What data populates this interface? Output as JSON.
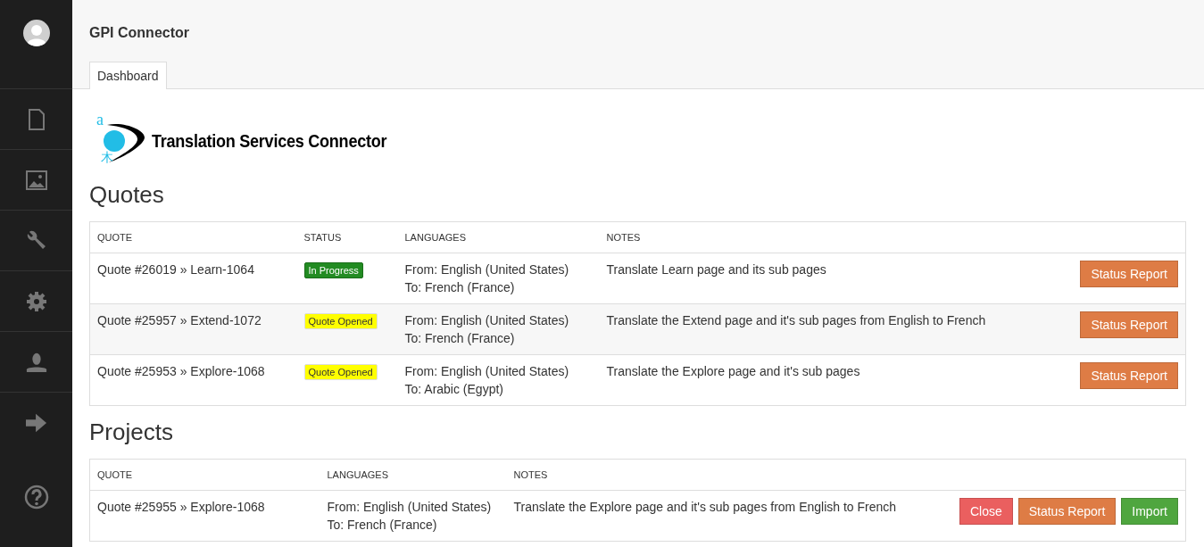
{
  "header": {
    "title": "GPI Connector"
  },
  "tabs": [
    {
      "label": "Dashboard",
      "selected": true
    }
  ],
  "logo": {
    "glyph_top": "a",
    "glyph_bottom": "木",
    "text": "Translation Services Connector"
  },
  "quotes": {
    "heading": "Quotes",
    "columns": [
      "QUOTE",
      "STATUS",
      "LANGUAGES",
      "NOTES"
    ],
    "rows": [
      {
        "quote": "Quote #26019 » Learn-1064",
        "status": {
          "label": "In Progress",
          "kind": "in_progress"
        },
        "from": "From: English (United States)",
        "to": "To: French (France)",
        "notes": "Translate Learn page and its sub pages",
        "buttons": [
          {
            "label": "Status Report",
            "kind": "status"
          }
        ]
      },
      {
        "quote": "Quote #25957 » Extend-1072",
        "status": {
          "label": "Quote Opened",
          "kind": "opened"
        },
        "from": "From: English (United States)",
        "to": "To: French (France)",
        "notes": "Translate the Extend page and it's sub pages from English to French",
        "buttons": [
          {
            "label": "Status Report",
            "kind": "status"
          }
        ]
      },
      {
        "quote": "Quote #25953 » Explore-1068",
        "status": {
          "label": "Quote Opened",
          "kind": "opened"
        },
        "from": "From: English (United States)",
        "to": "To: Arabic (Egypt)",
        "notes": "Translate the Explore page and it's sub pages",
        "buttons": [
          {
            "label": "Status Report",
            "kind": "status"
          }
        ]
      }
    ]
  },
  "projects": {
    "heading": "Projects",
    "columns": [
      "QUOTE",
      "LANGUAGES",
      "NOTES"
    ],
    "rows": [
      {
        "quote": "Quote #25955 » Explore-1068",
        "from": "From: English (United States)",
        "to": "To: French (France)",
        "notes": "Translate the Explore page and it's sub pages from English to French",
        "buttons": [
          {
            "label": "Close",
            "kind": "close"
          },
          {
            "label": "Status Report",
            "kind": "status"
          },
          {
            "label": "Import",
            "kind": "import"
          }
        ]
      }
    ]
  }
}
